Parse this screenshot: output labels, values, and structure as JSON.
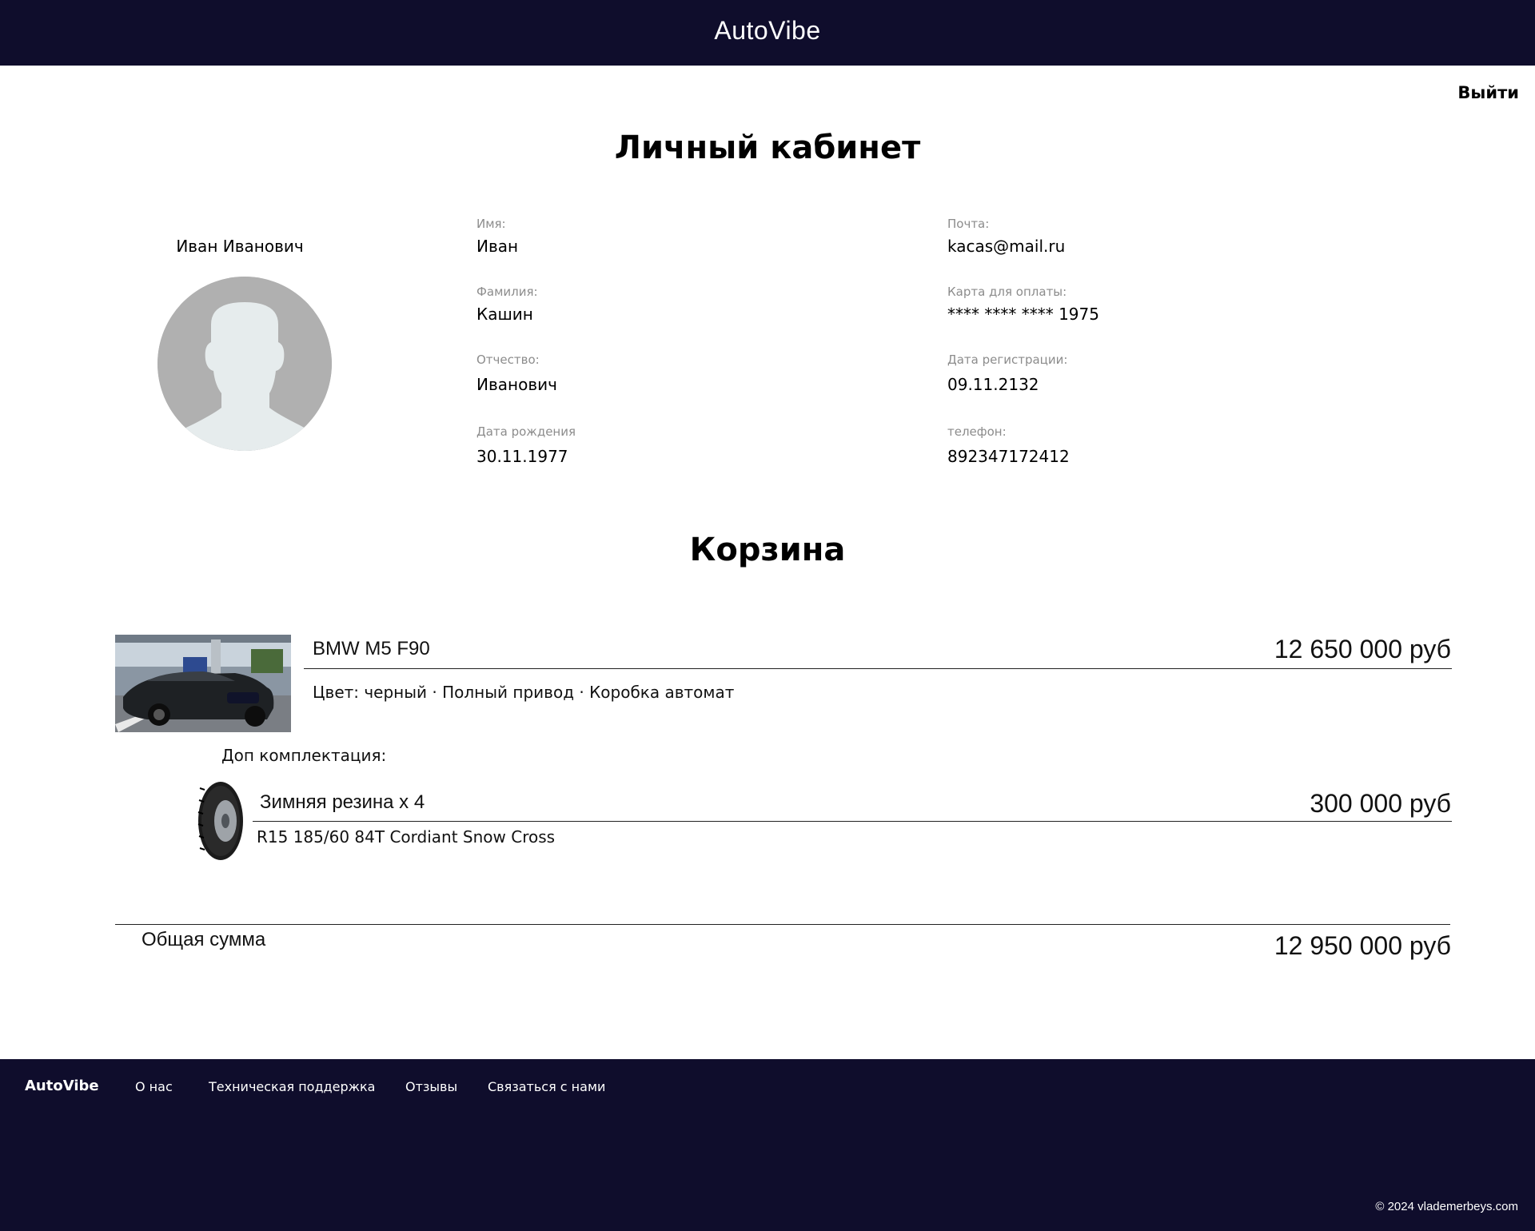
{
  "header": {
    "brand": "AutoVibe",
    "logout_label": "Выйти"
  },
  "profile": {
    "title": "Личный кабинет",
    "display_name": "Иван Иванович",
    "fields": {
      "first_name": {
        "label": "Имя:",
        "value": "Иван"
      },
      "last_name": {
        "label": "Фамилия:",
        "value": "Кашин"
      },
      "patronymic": {
        "label": "Отчество:",
        "value": "Иванович"
      },
      "birth_date": {
        "label": "Дата рождения",
        "value": "30.11.1977"
      },
      "email": {
        "label": "Почта:",
        "value": "kacas@mail.ru"
      },
      "card": {
        "label": "Карта для оплаты:",
        "value": "**** **** **** 1975"
      },
      "registration_date": {
        "label": "Дата регистрации:",
        "value": "09.11.2132"
      },
      "phone": {
        "label": "телефон:",
        "value": "892347172412"
      }
    }
  },
  "cart": {
    "title": "Корзина",
    "main_item": {
      "name": "BMW M5 F90",
      "price": "12 650 000 руб",
      "description": "Цвет: черный · Полный привод · Коробка автомат"
    },
    "extras_label": "Доп комплектация:",
    "extra_item": {
      "name": "Зимняя резина x 4",
      "price": "300 000 руб",
      "description": "R15 185/60 84T Cordiant Snow Cross"
    },
    "total_label": "Общая сумма",
    "total_value": "12 950 000 руб"
  },
  "footer": {
    "brand": "AutoVibe",
    "links": [
      "О нас",
      "Техническая поддержка",
      "Отзывы",
      "Связаться с нами"
    ],
    "copyright": "© 2024 vlademerbeys.com"
  },
  "colors": {
    "header_bg": "#0f0d2c",
    "footer_bg": "#0f0d2c",
    "avatar_bg": "#b0b0b0"
  }
}
